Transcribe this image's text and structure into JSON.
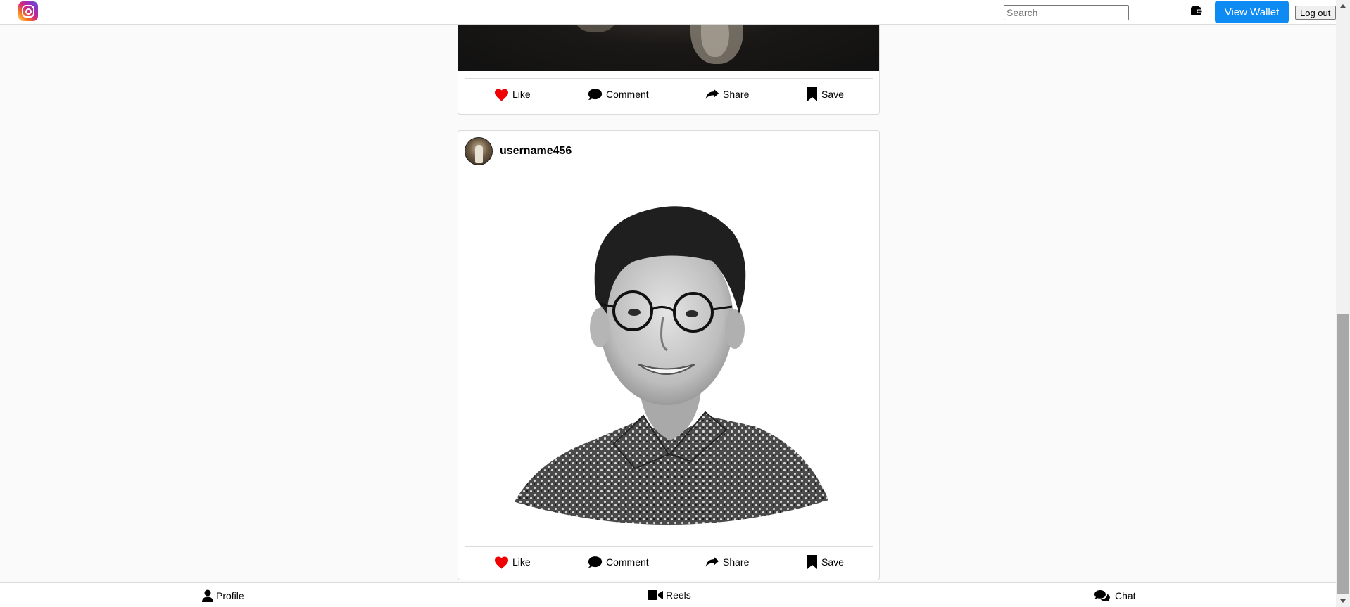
{
  "topbar": {
    "logo_icon": "instagram-logo",
    "search_placeholder": "Search",
    "wallet_icon": "wallet-icon",
    "view_wallet_label": "View Wallet",
    "logout_label": "Log out"
  },
  "posts": [
    {
      "actions": {
        "like": "Like",
        "comment": "Comment",
        "share": "Share",
        "save": "Save"
      }
    },
    {
      "username": "username456",
      "actions": {
        "like": "Like",
        "comment": "Comment",
        "share": "Share",
        "save": "Save"
      }
    }
  ],
  "bottom_nav": {
    "profile": "Profile",
    "reels": "Reels",
    "chat": "Chat"
  },
  "colors": {
    "accent": "#0d8bf2",
    "like_heart": "#f00000",
    "background": "#fafafa"
  }
}
